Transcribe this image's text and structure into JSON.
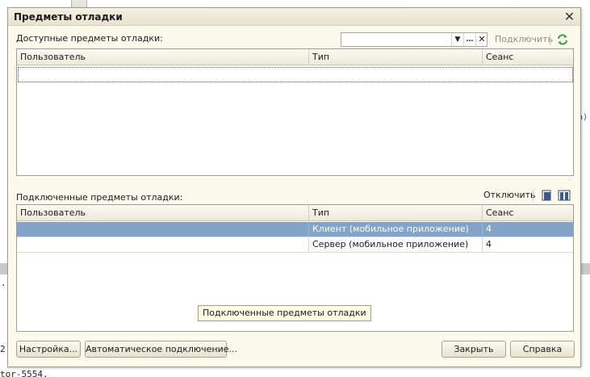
{
  "background": {
    "right_code_fragment": "a)",
    "left_fragment_dot": ".",
    "left_fragment_num": "2",
    "bottom_fragment": "tor-5554."
  },
  "dialog": {
    "title": "Предметы отладки",
    "close_icon": "close-icon"
  },
  "available": {
    "label": "Доступные предметы отладки:",
    "search": {
      "value": "",
      "placeholder": ""
    },
    "connect_label": "Подключить",
    "refresh_icon": "refresh-icon",
    "columns": [
      "Пользователь",
      "Тип",
      "Сеанс"
    ],
    "rows": []
  },
  "connected": {
    "label": "Подключенные предметы отладки:",
    "disconnect_label": "Отключить",
    "columns": [
      "Пользователь",
      "Тип",
      "Сеанс"
    ],
    "rows": [
      {
        "user": "",
        "type": "Клиент (мобильное приложение)",
        "session": "4",
        "selected": true
      },
      {
        "user": "",
        "type": "Сервер (мобильное приложение)",
        "session": "4",
        "selected": false
      }
    ],
    "tooltip": "Подключенные предметы отладки"
  },
  "footer": {
    "settings_label": "Настройка...",
    "auto_connect_label": "Автоматическое подключение...",
    "close_label": "Закрыть",
    "help_label": "Справка"
  },
  "colors": {
    "dialog_bg": "#fbfaed",
    "selection": "#84a3c8",
    "refresh_green": "#2e9a2e"
  }
}
